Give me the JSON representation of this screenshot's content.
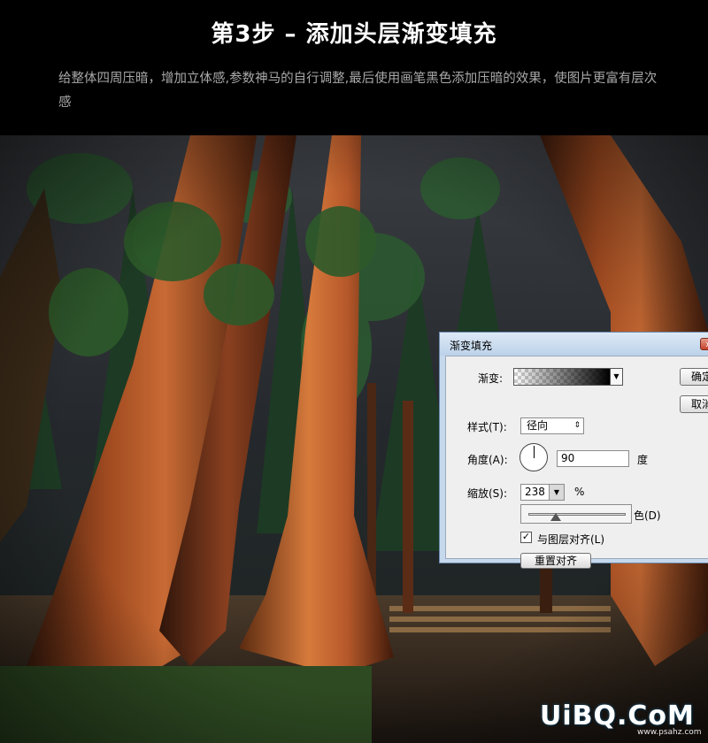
{
  "header": {
    "title": "第3步 – 添加头层渐变填充",
    "description": "给整体四周压暗，增加立体感,参数神马的自行调整,最后使用画笔黑色添加压暗的效果，使图片更富有层次感"
  },
  "dialog": {
    "title": "渐变填充",
    "close_label": "x",
    "gradient_label": "渐变:",
    "style_label": "样式(T):",
    "style_value": "径向",
    "angle_label": "角度(A):",
    "angle_value": "90",
    "angle_unit": "度",
    "scale_label": "缩放(S):",
    "scale_value": "238",
    "scale_unit": "%",
    "partial_label": "色(D)",
    "align_label": "与图层对齐(L)",
    "align_checked": true,
    "reset_align_button": "重置对齐",
    "ok_button": "确定",
    "cancel_button": "取消"
  },
  "watermark": {
    "main": "UiBQ.CoM",
    "sub": "www.psahz.com"
  }
}
